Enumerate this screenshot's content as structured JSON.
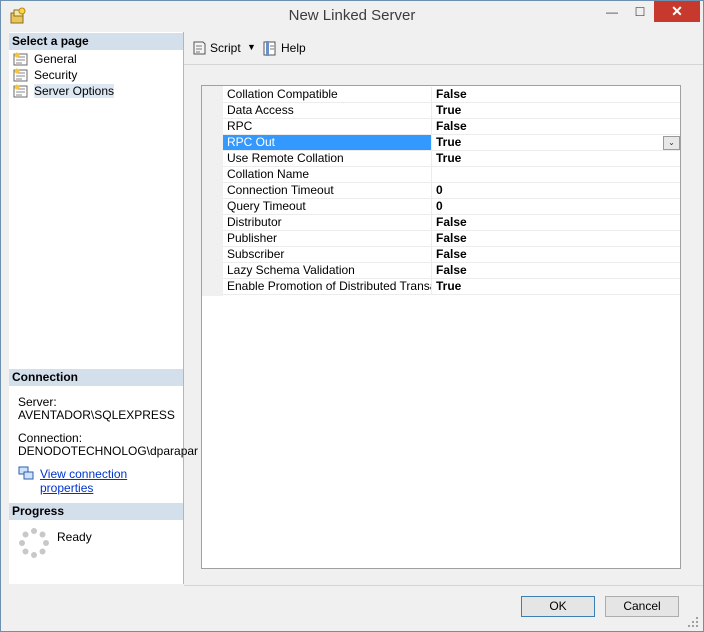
{
  "window": {
    "title": "New Linked Server",
    "close_glyph": "✕",
    "minimize_glyph": "—",
    "maximize_glyph": "☐"
  },
  "left_pane": {
    "select_page_header": "Select a page",
    "pages": [
      {
        "label": "General",
        "icon": "page-icon"
      },
      {
        "label": "Security",
        "icon": "page-icon"
      },
      {
        "label": "Server Options",
        "icon": "page-icon",
        "selected": true
      }
    ],
    "connection_header": "Connection",
    "server_label": "Server:",
    "server_value": "AVENTADOR\\SQLEXPRESS",
    "connection_label": "Connection:",
    "connection_value": "DENODOTECHNOLOG\\dparapar",
    "view_connection_link": "View connection properties",
    "progress_header": "Progress",
    "progress_status": "Ready"
  },
  "toolbar": {
    "script_label": "Script",
    "script_dropdown_glyph": "▼",
    "help_label": "Help"
  },
  "properties": [
    {
      "name": "Collation Compatible",
      "value": "False"
    },
    {
      "name": "Data Access",
      "value": "True"
    },
    {
      "name": "RPC",
      "value": "False"
    },
    {
      "name": "RPC Out",
      "value": "True",
      "selected": true
    },
    {
      "name": "Use Remote Collation",
      "value": "True"
    },
    {
      "name": "Collation Name",
      "value": ""
    },
    {
      "name": "Connection Timeout",
      "value": "0"
    },
    {
      "name": "Query Timeout",
      "value": "0"
    },
    {
      "name": "Distributor",
      "value": "False"
    },
    {
      "name": "Publisher",
      "value": "False"
    },
    {
      "name": "Subscriber",
      "value": "False"
    },
    {
      "name": "Lazy Schema Validation",
      "value": "False"
    },
    {
      "name": "Enable Promotion of Distributed Transaction",
      "value": "True"
    }
  ],
  "dropdown_glyph": "⌄",
  "buttons": {
    "ok_label": "OK",
    "cancel_label": "Cancel"
  },
  "colors": {
    "selection": "#3399ff",
    "section_header": "#d4dfec",
    "close_button": "#c7392d",
    "link": "#0033cc"
  }
}
